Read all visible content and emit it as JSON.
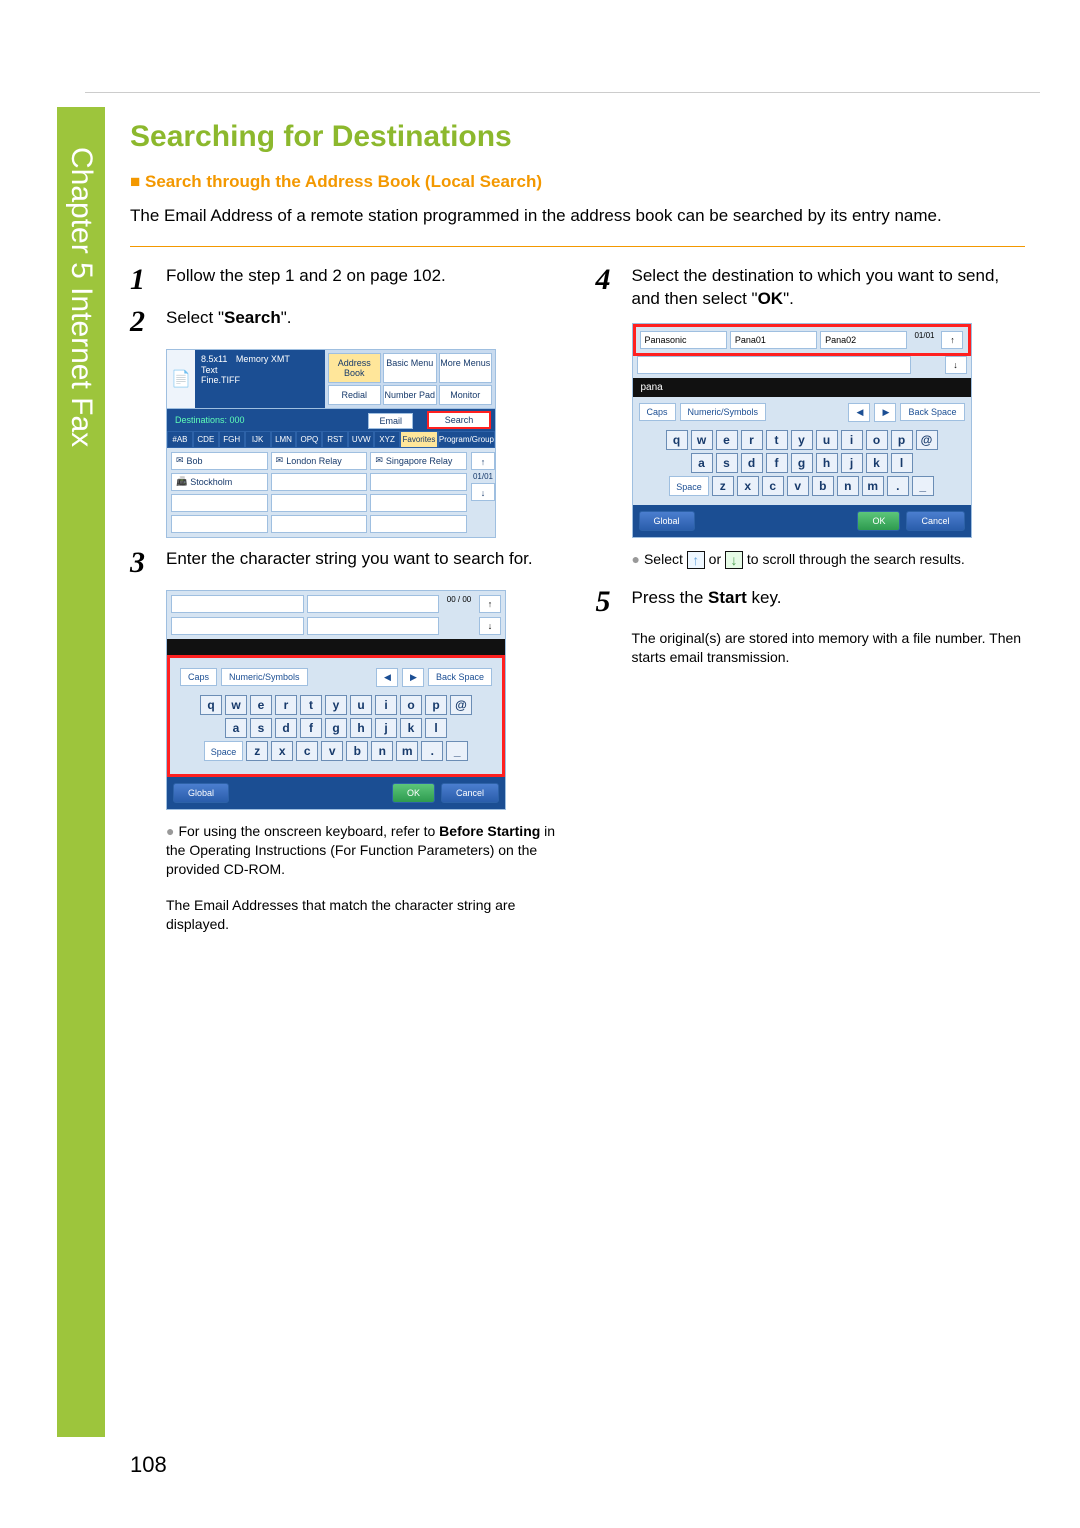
{
  "sidebar": {
    "label": "Chapter 5    Internet Fax"
  },
  "title": "Searching for Destinations",
  "subheader": "■ Search through the Address Book (Local Search)",
  "intro_a": "The ",
  "intro_b": "Email Address",
  "intro_c": " of a remote station programmed in the address book can be searched by its entry name.",
  "steps": {
    "s1": {
      "num": "1",
      "text": "Follow the step 1 and 2 on page 102."
    },
    "s2": {
      "num": "2",
      "text_a": "Select \"",
      "text_b": "Search",
      "text_c": "\"."
    },
    "s3": {
      "num": "3",
      "text": "Enter the character string you want to search for."
    },
    "s3_note_a": "For using the onscreen keyboard, refer to ",
    "s3_note_b": "Before Starting",
    "s3_note_c": " in the Operating Instructions (For Function Parameters) on the provided CD-ROM.",
    "s3_para": "The Email Addresses that match the character string are displayed.",
    "s4": {
      "num": "4",
      "text_a": "Select the destination to which you want to send, and then select \"",
      "text_b": "OK",
      "text_c": "\"."
    },
    "s4_note_a": "Select ",
    "s4_note_b": " or ",
    "s4_note_c": " to scroll through the search results.",
    "s5": {
      "num": "5",
      "text_a": "Press the ",
      "text_b": "Start",
      "text_c": " key."
    },
    "s5_para": "The original(s) are stored into memory with a file number. Then starts email transmission."
  },
  "ab": {
    "size": "8.5x11",
    "status1": "Memory XMT",
    "status2": "Text",
    "status3": "Fine.TIFF",
    "tabs": [
      "Address Book",
      "Basic Menu",
      "More Menus",
      "Redial",
      "Number Pad",
      "Monitor",
      "Email",
      "Search"
    ],
    "dest": "Destinations: 000",
    "idx": [
      "#AB",
      "CDE",
      "FGH",
      "IJK",
      "LMN",
      "OPQ",
      "RST",
      "UVW",
      "XYZ"
    ],
    "favorites": "Favorites",
    "program": "Program/Group",
    "items": [
      "Bob",
      "Stockholm",
      "London Relay",
      "Singapore Relay"
    ],
    "pg": "01",
    "pgtotal": "01"
  },
  "kb3": {
    "tabs": [
      "",
      ""
    ],
    "pg": "00",
    "pgtotal": "00",
    "black": "",
    "ctl": {
      "caps": "Caps",
      "numsym": "Numeric/Symbols",
      "back": "Back Space",
      "space": "Space"
    },
    "rows": [
      [
        "q",
        "w",
        "e",
        "r",
        "t",
        "y",
        "u",
        "i",
        "o",
        "p",
        "@"
      ],
      [
        "a",
        "s",
        "d",
        "f",
        "g",
        "h",
        "j",
        "k",
        "l"
      ],
      [
        "z",
        "x",
        "c",
        "v",
        "b",
        "n",
        "m",
        ".",
        "_"
      ]
    ],
    "global": "Global",
    "ok": "OK",
    "cancel": "Cancel"
  },
  "kb4": {
    "tabs": [
      "Panasonic",
      "Pana01",
      "Pana02"
    ],
    "pg": "01",
    "pgtotal": "01",
    "black": "pana",
    "ctl": {
      "caps": "Caps",
      "numsym": "Numeric/Symbols",
      "back": "Back Space",
      "space": "Space"
    },
    "rows": [
      [
        "q",
        "w",
        "e",
        "r",
        "t",
        "y",
        "u",
        "i",
        "o",
        "p",
        "@"
      ],
      [
        "a",
        "s",
        "d",
        "f",
        "g",
        "h",
        "j",
        "k",
        "l"
      ],
      [
        "z",
        "x",
        "c",
        "v",
        "b",
        "n",
        "m",
        ".",
        "_"
      ]
    ],
    "global": "Global",
    "ok": "OK",
    "cancel": "Cancel"
  },
  "page_num": "108"
}
